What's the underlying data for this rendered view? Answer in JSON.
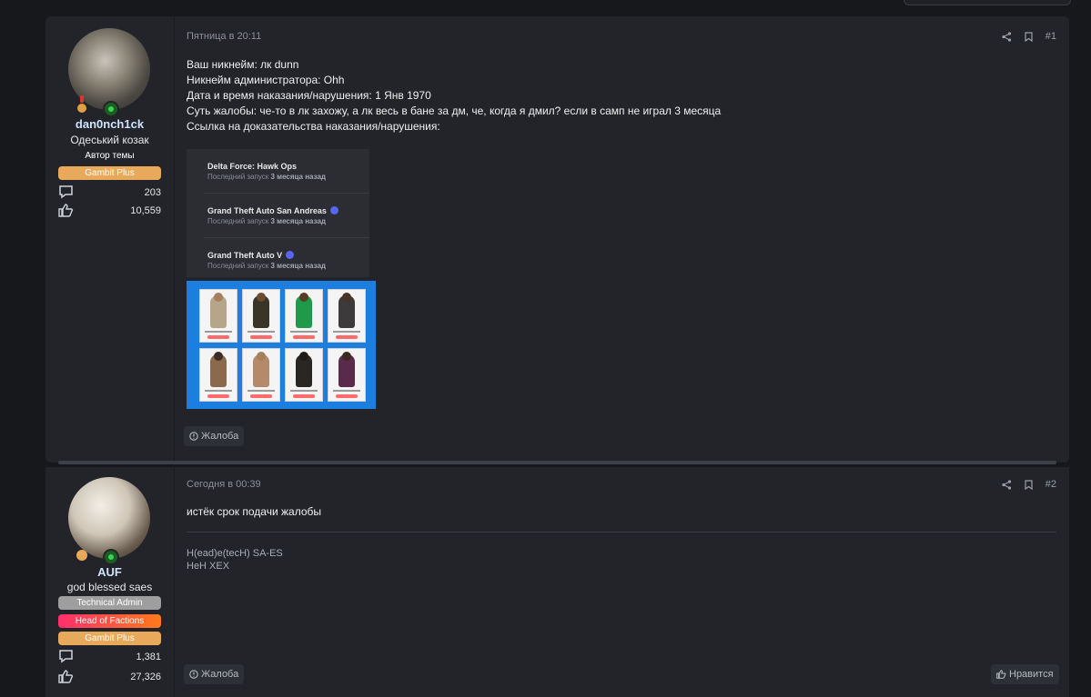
{
  "posts": [
    {
      "author": {
        "name": "dan0nch1ck",
        "title": "Одеський козак",
        "banner": "Автор темы",
        "badges": [
          {
            "label": "Gambit Plus",
            "color": "#e8a95a"
          }
        ],
        "messages": "203",
        "reactions": "10,559"
      },
      "date": "Пятница в 20:11",
      "number": "#1",
      "lines": [
        "Ваш никнейм: лк dunn",
        "Никнейм администратора: Ohh",
        "Дата и время наказания/нарушения: 1 Янв 1970",
        "Суть жалобы: че-то в лк захожу, а лк весь в бане за дм, че, когда я дмил? если в самп не играл 3 месяца",
        "Ссылка на доказательства наказания/нарушения:"
      ],
      "games": [
        {
          "title": "Delta Force: Hawk Ops",
          "status_prefix": "Последний запуск",
          "status_value": "3 месяца назад",
          "verified": false
        },
        {
          "title": "Grand Theft Auto San Andreas",
          "status_prefix": "Последний запуск",
          "status_value": "3 месяца назад",
          "verified": true
        },
        {
          "title": "Grand Theft Auto V",
          "status_prefix": "Последний запуск",
          "status_value": "3 месяца назад",
          "verified": true
        }
      ],
      "report_label": "Жалоба"
    },
    {
      "author": {
        "name": "AUF",
        "title": "god blessed saes",
        "badges": [
          {
            "label": "Technical Admin",
            "color": "#9e9e9e"
          },
          {
            "label": "Head of Factions",
            "color": "#ff2f6d"
          },
          {
            "label": "Gambit Plus",
            "color": "#e8a95a"
          }
        ],
        "messages": "1,381",
        "reactions": "27,326"
      },
      "date": "Сегодня в 00:39",
      "number": "#2",
      "text": "истёк срок подачи жалобы",
      "signature": [
        "H(ead)e(tecH) SA-ES",
        "HeH XEX"
      ],
      "report_label": "Жалоба",
      "like_label": "Нравится"
    }
  ],
  "icons": {
    "share": "share-icon",
    "bookmark": "bookmark-icon",
    "messages": "messages-icon",
    "reactions": "thumbs-up-icon",
    "report": "report-icon"
  },
  "colors": {
    "background": "#17181c",
    "post_bg": "#22242a",
    "username": "#cfe3ff",
    "online": "#39d353",
    "verified": "#5865f2",
    "skins_bg": "#1c7fe0"
  }
}
